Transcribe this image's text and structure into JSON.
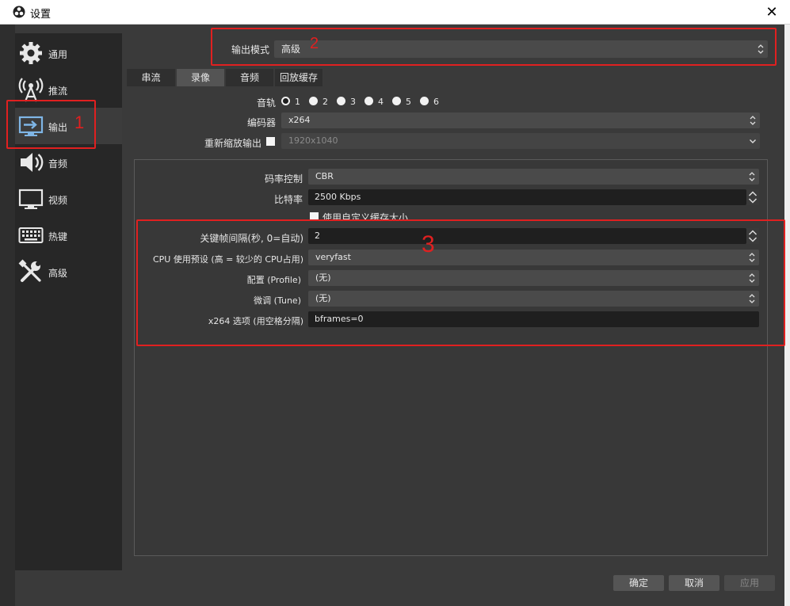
{
  "window": {
    "title": "设置",
    "close_glyph": "✕"
  },
  "sidebar": {
    "items": [
      {
        "label": "通用",
        "icon": "gear-icon"
      },
      {
        "label": "推流",
        "icon": "antenna-icon"
      },
      {
        "label": "输出",
        "icon": "monitor-output-icon",
        "active": true
      },
      {
        "label": "音频",
        "icon": "speaker-icon"
      },
      {
        "label": "视频",
        "icon": "monitor-icon"
      },
      {
        "label": "热键",
        "icon": "keyboard-icon"
      },
      {
        "label": "高级",
        "icon": "tools-icon"
      }
    ]
  },
  "output_mode": {
    "label": "输出模式",
    "value": "高级"
  },
  "tabs": [
    {
      "label": "串流"
    },
    {
      "label": "录像",
      "active": true
    },
    {
      "label": "音频"
    },
    {
      "label": "回放缓存"
    }
  ],
  "recording": {
    "track_label": "音轨",
    "tracks": [
      "1",
      "2",
      "3",
      "4",
      "5",
      "6"
    ],
    "encoder_label": "编码器",
    "encoder_value": "x264",
    "rescale_label": "重新缩放输出",
    "rescale_value": "1920x1040"
  },
  "encoder_settings": {
    "rate_control_label": "码率控制",
    "rate_control_value": "CBR",
    "bitrate_label": "比特率",
    "bitrate_value": "2500 Kbps",
    "custom_buffer_label": "使用自定义缓存大小",
    "keyframe_label": "关键帧间隔(秒, 0=自动)",
    "keyframe_value": "2",
    "cpu_preset_label": "CPU 使用预设 (高 = 较少的 CPU占用)",
    "cpu_preset_value": "veryfast",
    "profile_label": "配置 (Profile)",
    "profile_value": "(无)",
    "tune_label": "微调 (Tune)",
    "tune_value": "(无)",
    "x264_opts_label": "x264 选项 (用空格分隔)",
    "x264_opts_value": "bframes=0"
  },
  "annotations": {
    "one": "1",
    "two": "2",
    "three": "3"
  },
  "buttons": {
    "ok": "确定",
    "cancel": "取消",
    "apply": "应用"
  },
  "colors": {
    "annotation": "#e02020",
    "background": "#3a3a3a",
    "sidebar": "#272727"
  }
}
